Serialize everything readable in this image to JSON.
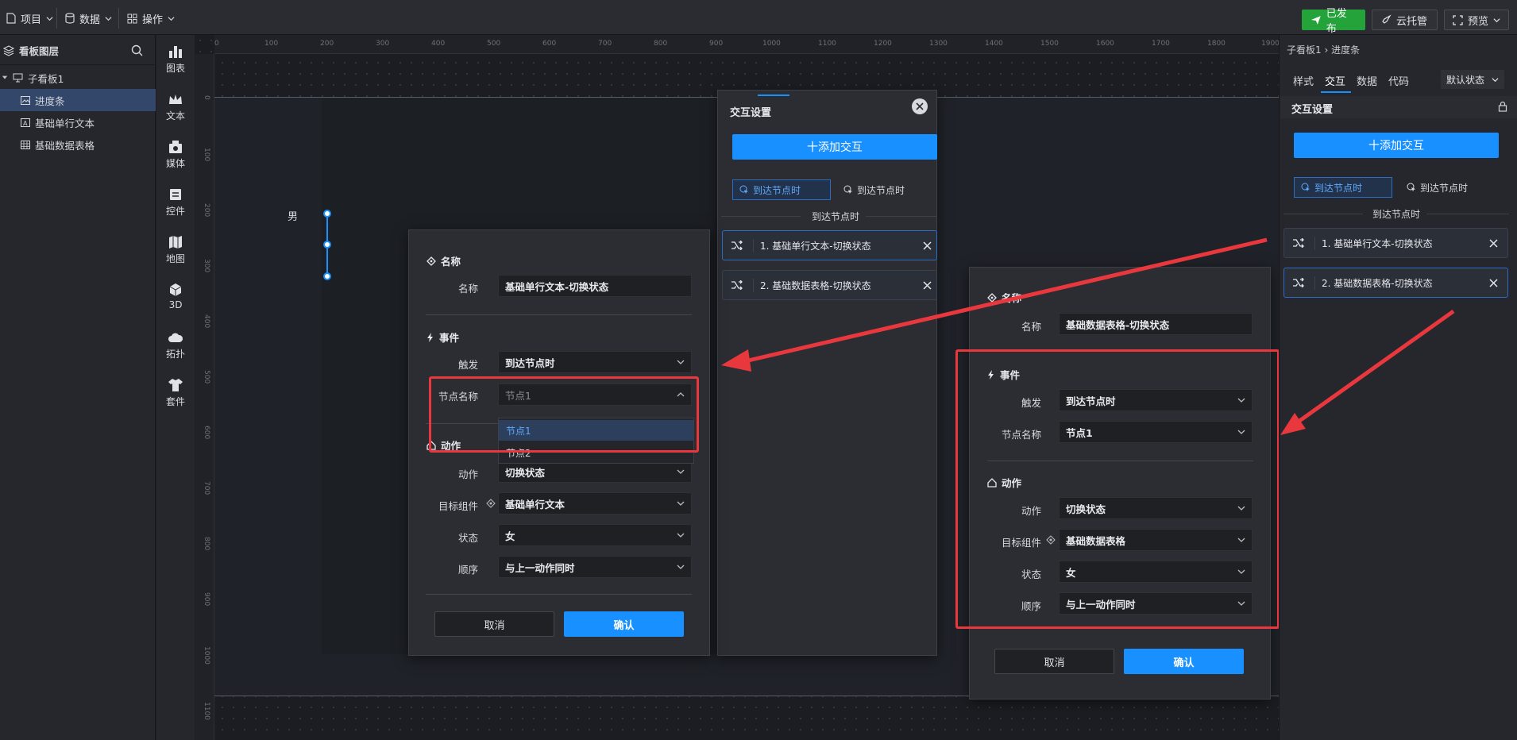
{
  "topbar": {
    "menus": [
      "项目",
      "数据",
      "操作"
    ],
    "published": "已发布",
    "cloud": "云托管",
    "preview": "预览"
  },
  "layers": {
    "title": "看板图层",
    "board": "子看板1",
    "items": [
      "进度条",
      "基础单行文本",
      "基础数据表格"
    ]
  },
  "tools": [
    "图表",
    "文本",
    "媒体",
    "控件",
    "地图",
    "3D",
    "拓扑",
    "套件"
  ],
  "ruler": {
    "top": [
      "0",
      "100",
      "200",
      "300",
      "400",
      "500",
      "600",
      "700",
      "800",
      "900",
      "1000",
      "1100",
      "1200",
      "1300",
      "1400",
      "1500",
      "1600",
      "1700",
      "1800",
      "1900"
    ],
    "left": [
      "0",
      "100",
      "200",
      "300",
      "400",
      "500",
      "600",
      "700",
      "800",
      "900",
      "1000",
      "1100"
    ]
  },
  "canvas": {
    "label_male": "男"
  },
  "interaction_panel": {
    "title": "交互设置",
    "add": "十添加交互",
    "tab_active": "到达节点时",
    "tab_other": "到达节点时",
    "section": "到达节点时",
    "items": [
      "1. 基础单行文本-切换状态",
      "2. 基础数据表格-切换状态"
    ]
  },
  "dialog_left": {
    "name_section": "名称",
    "name_label": "名称",
    "name_value": "基础单行文本-切换状态",
    "event_section": "事件",
    "trigger_label": "触发",
    "trigger_value": "到达节点时",
    "node_label": "节点名称",
    "node_placeholder": "节点1",
    "node_options": [
      "节点1",
      "节点2"
    ],
    "action_section": "动作",
    "action_label": "动作",
    "action_value": "切换状态",
    "target_label": "目标组件",
    "target_value": "基础单行文本",
    "state_label": "状态",
    "state_value": "女",
    "order_label": "顺序",
    "order_value": "与上一动作同时",
    "cancel": "取消",
    "confirm": "确认"
  },
  "dialog_right": {
    "name_section": "名称",
    "name_label": "名称",
    "name_value": "基础数据表格-切换状态",
    "event_section": "事件",
    "trigger_label": "触发",
    "trigger_value": "到达节点时",
    "node_label": "节点名称",
    "node_value": "节点1",
    "action_section": "动作",
    "action_label": "动作",
    "action_value": "切换状态",
    "target_label": "目标组件",
    "target_value": "基础数据表格",
    "state_label": "状态",
    "state_value": "女",
    "order_label": "顺序",
    "order_value": "与上一动作同时",
    "cancel": "取消",
    "confirm": "确认"
  },
  "right_panel": {
    "breadcrumb": "子看板1 › 进度条",
    "tabs": [
      "样式",
      "交互",
      "数据",
      "代码"
    ],
    "state_select": "默认状态",
    "section": "交互设置",
    "add": "十添加交互",
    "tab_active": "到达节点时",
    "tab_other": "到达节点时",
    "divider": "到达节点时",
    "items": [
      "1. 基础单行文本-切换状态",
      "2. 基础数据表格-切换状态"
    ]
  },
  "colors": {
    "accent": "#1890ff",
    "published": "#23a33a",
    "highlight": "#e8383d"
  }
}
